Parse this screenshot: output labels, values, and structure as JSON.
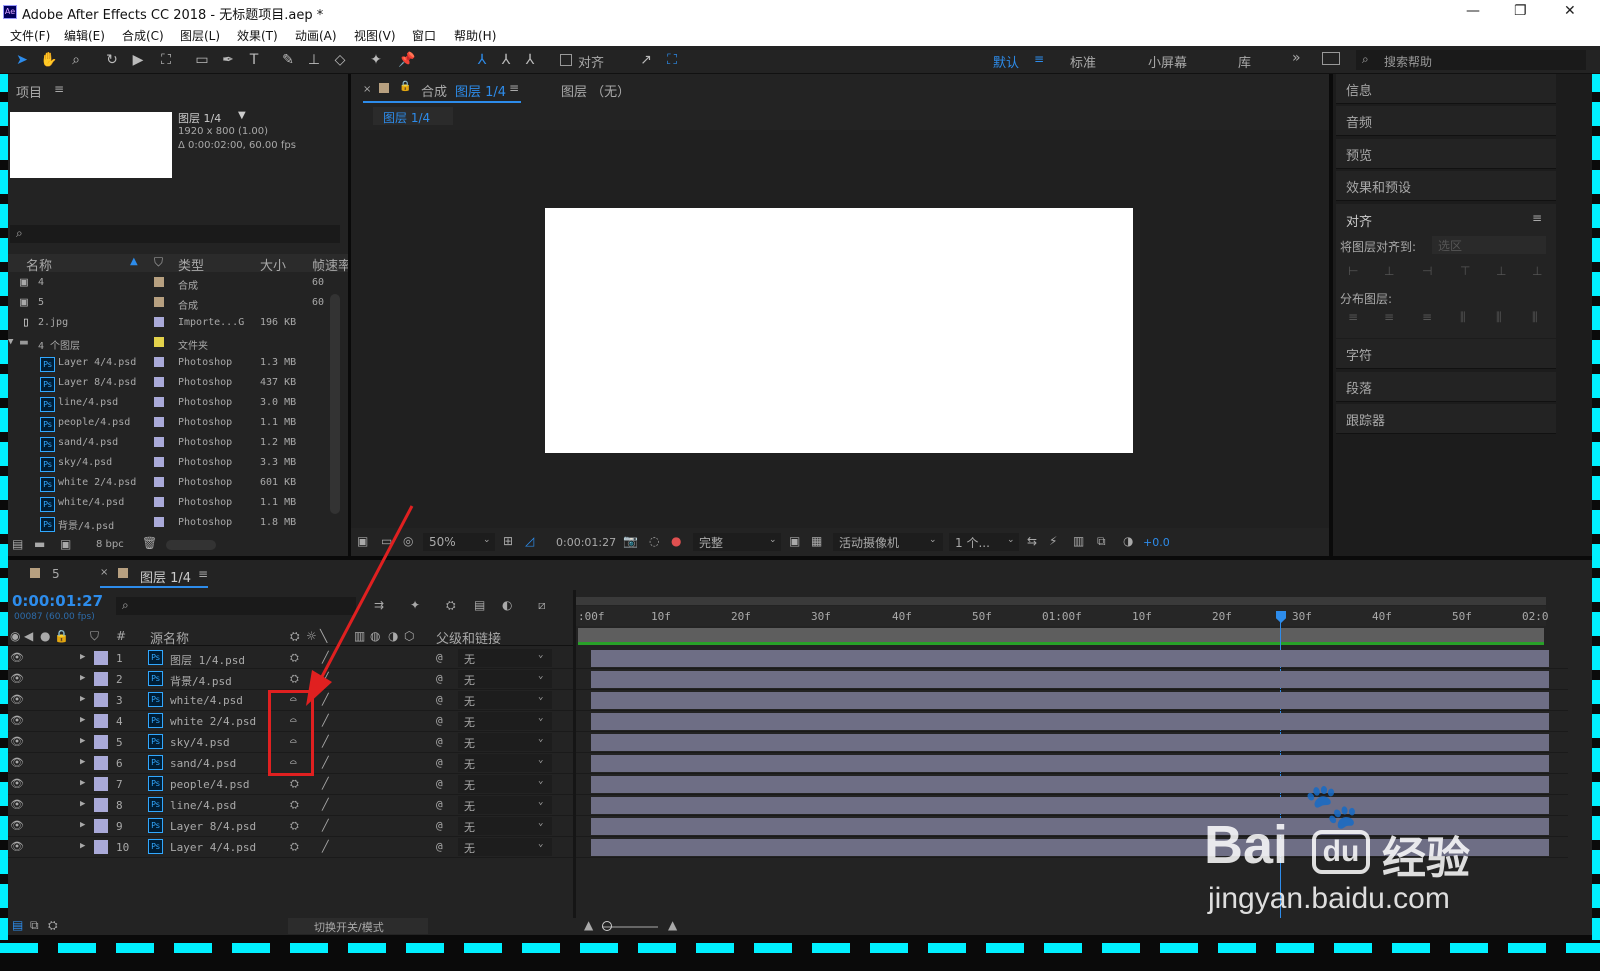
{
  "app": {
    "title": "Adobe After Effects CC 2018 - 无标题项目.aep *",
    "icon_label": "Ae"
  },
  "menu": [
    "文件(F)",
    "编辑(E)",
    "合成(C)",
    "图层(L)",
    "效果(T)",
    "动画(A)",
    "视图(V)",
    "窗口",
    "帮助(H)"
  ],
  "toolbar": {
    "align_label": "对齐",
    "workspaces": [
      "默认",
      "标准",
      "小屏幕",
      "库"
    ],
    "search_placeholder": "搜索帮助"
  },
  "project": {
    "title": "项目",
    "selected_name": "图层 1/4",
    "selected_info1": "1920 x 800 (1.00)",
    "selected_info2": "Δ 0:00:02:00, 60.00 fps",
    "search_placeholder": "",
    "columns": [
      "名称",
      "类型",
      "大小",
      "帧速率"
    ],
    "bpc": "8 bpc",
    "items": [
      {
        "name": "4",
        "type": "合成",
        "size": "",
        "fps": "60",
        "color": "#b7a080",
        "icon": "comp-icon"
      },
      {
        "name": "5",
        "type": "合成",
        "size": "",
        "fps": "60",
        "color": "#b7a080",
        "icon": "comp-icon"
      },
      {
        "name": "2.jpg",
        "type": "Importe...G",
        "size": "196 KB",
        "fps": "",
        "color": "#a9a9d8",
        "icon": "image-file-icon"
      },
      {
        "name": "4 个图层",
        "type": "文件夹",
        "size": "",
        "fps": "",
        "color": "#e3d24b",
        "icon": "folder-icon"
      },
      {
        "name": "Layer 4/4.psd",
        "type": "Photoshop",
        "size": "1.3 MB",
        "fps": "",
        "color": "#a9a9d8",
        "icon": "ps-icon"
      },
      {
        "name": "Layer 8/4.psd",
        "type": "Photoshop",
        "size": "437 KB",
        "fps": "",
        "color": "#a9a9d8",
        "icon": "ps-icon"
      },
      {
        "name": "line/4.psd",
        "type": "Photoshop",
        "size": "3.0 MB",
        "fps": "",
        "color": "#a9a9d8",
        "icon": "ps-icon"
      },
      {
        "name": "people/4.psd",
        "type": "Photoshop",
        "size": "1.1 MB",
        "fps": "",
        "color": "#a9a9d8",
        "icon": "ps-icon"
      },
      {
        "name": "sand/4.psd",
        "type": "Photoshop",
        "size": "1.2 MB",
        "fps": "",
        "color": "#a9a9d8",
        "icon": "ps-icon"
      },
      {
        "name": "sky/4.psd",
        "type": "Photoshop",
        "size": "3.3 MB",
        "fps": "",
        "color": "#a9a9d8",
        "icon": "ps-icon"
      },
      {
        "name": "white 2/4.psd",
        "type": "Photoshop",
        "size": "601 KB",
        "fps": "",
        "color": "#a9a9d8",
        "icon": "ps-icon"
      },
      {
        "name": "white/4.psd",
        "type": "Photoshop",
        "size": "1.1 MB",
        "fps": "",
        "color": "#a9a9d8",
        "icon": "ps-icon"
      },
      {
        "name": "背景/4.psd",
        "type": "Photoshop",
        "size": "1.8 MB",
        "fps": "",
        "color": "#a9a9d8",
        "icon": "ps-icon"
      }
    ]
  },
  "viewer": {
    "tab_comp_prefix": "合成",
    "tab_comp_name": "图层 1/4",
    "tab_layer": "图层 （无）",
    "breadcrumb": "图层 1/4",
    "zoom": "50%",
    "timecode": "0:00:01:27",
    "resolution": "完整",
    "camera": "活动摄像机",
    "views": "1 个...",
    "exposure": "+0.0"
  },
  "right_panels": [
    "信息",
    "音频",
    "预览",
    "效果和预设",
    "对齐",
    "字符",
    "段落",
    "跟踪器"
  ],
  "align_panel": {
    "align_to_label": "将图层对齐到:",
    "align_to_value": "选区",
    "distribute_label": "分布图层:"
  },
  "timeline": {
    "tabs": [
      "5",
      "图层 1/4"
    ],
    "timecode": "0:00:01:27",
    "frame_info": "00087 (60.00 fps)",
    "col_num": "#",
    "col_source": "源名称",
    "col_parent": "父级和链接",
    "bottom_toggle": "切换开关/模式",
    "ruler": [
      ":00f",
      "10f",
      "20f",
      "30f",
      "40f",
      "50f",
      "01:00f",
      "10f",
      "20f",
      "30f",
      "40f",
      "50f",
      "02:0"
    ],
    "layers": [
      {
        "num": "1",
        "name": "图层 1/4.psd",
        "parent": "无",
        "collapse": false
      },
      {
        "num": "2",
        "name": "背景/4.psd",
        "parent": "无",
        "collapse": false
      },
      {
        "num": "3",
        "name": "white/4.psd",
        "parent": "无",
        "collapse": true
      },
      {
        "num": "4",
        "name": "white 2/4.psd",
        "parent": "无",
        "collapse": true
      },
      {
        "num": "5",
        "name": "sky/4.psd",
        "parent": "无",
        "collapse": true
      },
      {
        "num": "6",
        "name": "sand/4.psd",
        "parent": "无",
        "collapse": true
      },
      {
        "num": "7",
        "name": "people/4.psd",
        "parent": "无",
        "collapse": false
      },
      {
        "num": "8",
        "name": "line/4.psd",
        "parent": "无",
        "collapse": false
      },
      {
        "num": "9",
        "name": "Layer 8/4.psd",
        "parent": "无",
        "collapse": false
      },
      {
        "num": "10",
        "name": "Layer 4/4.psd",
        "parent": "无",
        "collapse": false
      }
    ]
  },
  "watermark": {
    "brand": "Bai",
    "brand2": "经验",
    "url": "jingyan.baidu.com"
  },
  "colors": {
    "accent": "#2d8ceb",
    "annotation": "#e02020",
    "frame": "#00f0ff",
    "layer_bar": "#6e6e85"
  }
}
